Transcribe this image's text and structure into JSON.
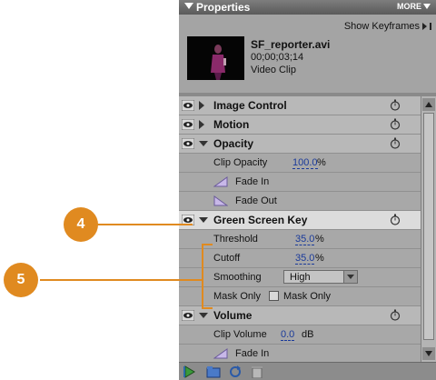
{
  "panel": {
    "title": "Properties",
    "more_label": "MORE",
    "show_keyframes": "Show Keyframes",
    "clip": {
      "name": "SF_reporter.avi",
      "timecode": "00;00;03;14",
      "type": "Video Clip"
    }
  },
  "effects": {
    "image_control": "Image Control",
    "motion": "Motion",
    "opacity": {
      "name": "Opacity",
      "clip_opacity_label": "Clip Opacity",
      "clip_opacity_value": "100.0",
      "clip_opacity_unit": "%",
      "fade_in": "Fade In",
      "fade_out": "Fade Out"
    },
    "green_screen": {
      "name": "Green Screen Key",
      "threshold_label": "Threshold",
      "threshold_value": "35.0",
      "threshold_unit": "%",
      "cutoff_label": "Cutoff",
      "cutoff_value": "35.0",
      "cutoff_unit": "%",
      "smoothing_label": "Smoothing",
      "smoothing_value": "High",
      "mask_only_label": "Mask Only",
      "mask_only_checkbox_label": "Mask Only",
      "mask_only_checked": false
    },
    "volume": {
      "name": "Volume",
      "clip_volume_label": "Clip Volume",
      "clip_volume_value": "0.0",
      "clip_volume_unit": "dB",
      "fade_in": "Fade In"
    }
  },
  "callouts": {
    "four": "4",
    "five": "5"
  },
  "colors": {
    "callout": "#e08a20",
    "value_link": "#1a3a9a",
    "panel_bg": "#a4a4a4"
  },
  "icons": [
    "eye-icon",
    "twirl-triangle-icon",
    "stopwatch-icon",
    "fade-in-icon",
    "fade-out-icon",
    "play-icon",
    "folder-icon",
    "refresh-icon",
    "trash-icon"
  ]
}
